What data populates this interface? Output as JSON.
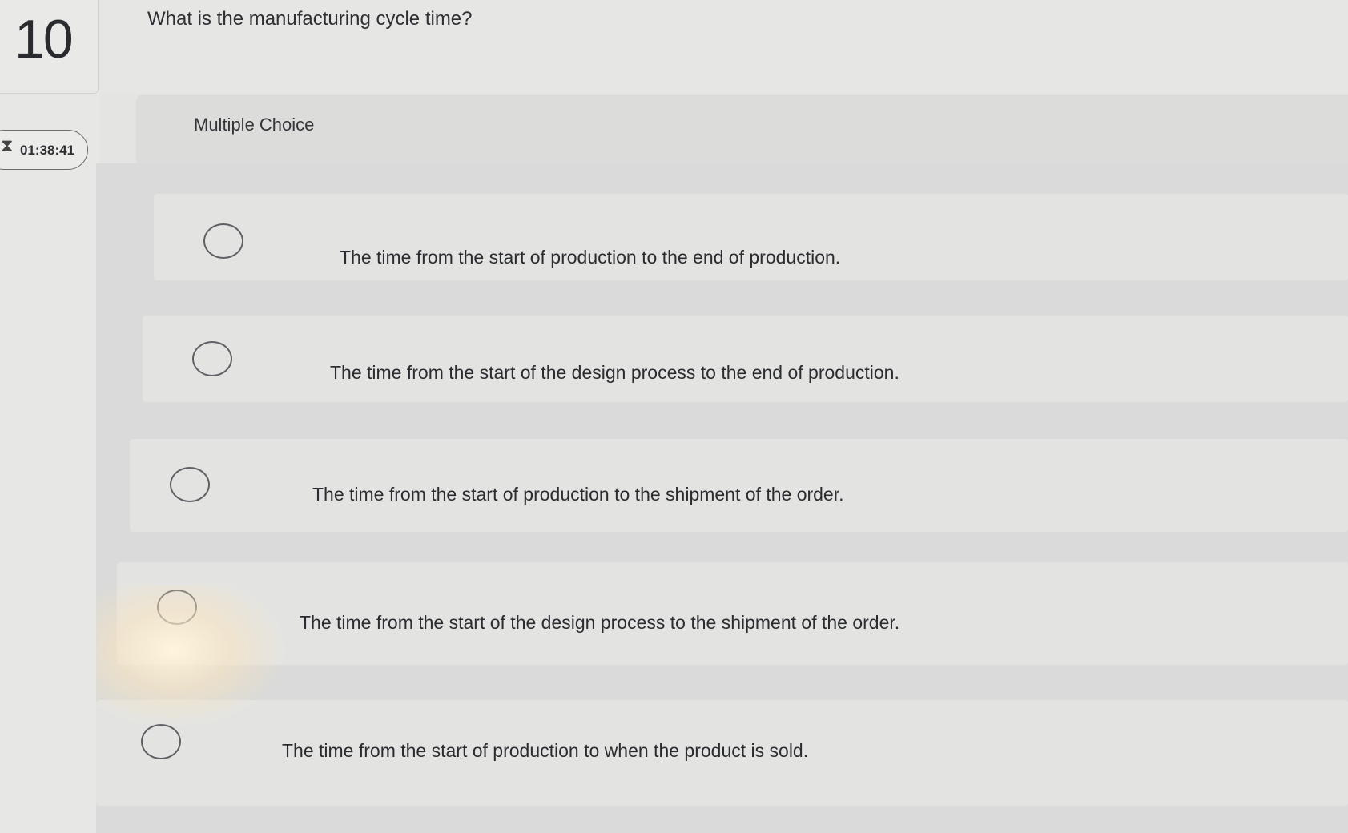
{
  "question": {
    "number": "10",
    "text": "What is the manufacturing cycle time?"
  },
  "timer": {
    "value": "01:38:41",
    "icon": "hourglass-icon"
  },
  "answer_section": {
    "type_label": "Multiple Choice",
    "options": [
      {
        "label": "The time from the start of production to the end of production."
      },
      {
        "label": "The time from the start of the design process to the end of production."
      },
      {
        "label": "The time from the start of production to the shipment of the order."
      },
      {
        "label": "The time from the start of the design process to the shipment of the order."
      },
      {
        "label": "The time from the start of production to when the product is sold."
      }
    ]
  }
}
